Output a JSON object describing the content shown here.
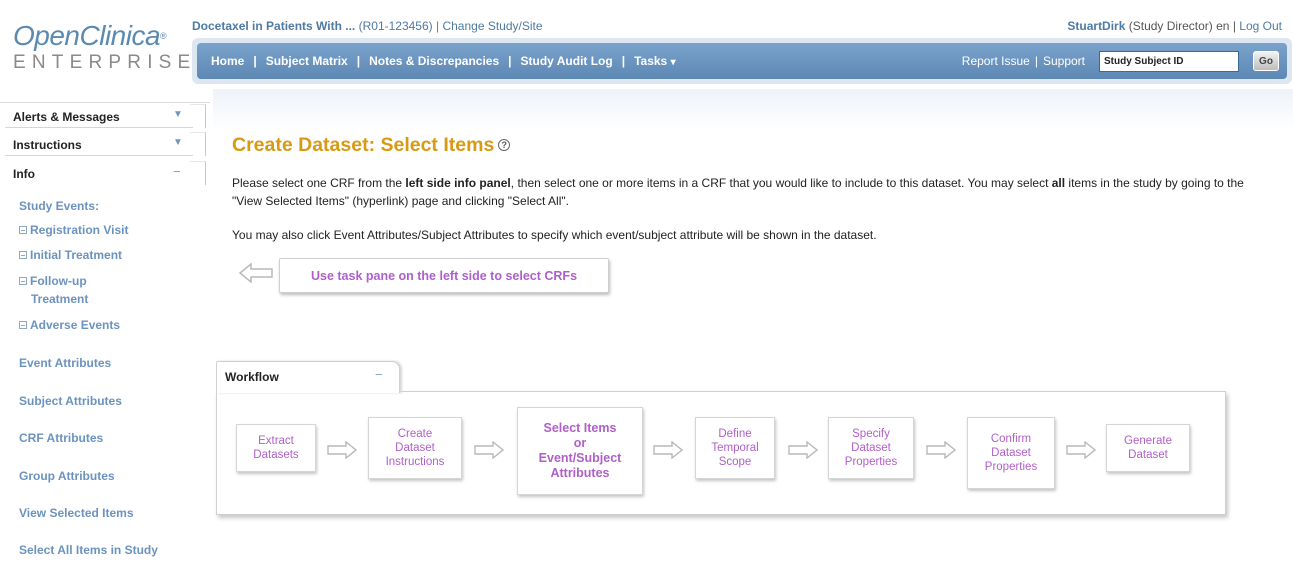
{
  "brand": {
    "name": "OpenClinica",
    "reg": "®",
    "edition": "ENTERPRISE"
  },
  "study": {
    "name": "Docetaxel in Patients With ...",
    "id": "(R01-123456)",
    "separator": "|",
    "change_link": "Change Study/Site"
  },
  "user": {
    "name": "StuartDirk",
    "role": "(Study Director)",
    "lang": "en",
    "separator": "|",
    "logout": "Log Out"
  },
  "nav": {
    "items": [
      "Home",
      "Subject Matrix",
      "Notes & Discrepancies",
      "Study Audit Log",
      "Tasks"
    ],
    "separator": "|",
    "tasks_caret": "▾",
    "report_issue": "Report Issue",
    "support": "Support",
    "right_separator": "|",
    "search_value": "Study Subject ID",
    "go_label": "Go"
  },
  "sidebar": {
    "panels": [
      {
        "title": "Alerts & Messages",
        "toggle": "▼"
      },
      {
        "title": "Instructions",
        "toggle": "▼"
      },
      {
        "title": "Info",
        "toggle": "−"
      }
    ],
    "study_events_label": "Study Events:",
    "events": [
      "Registration Visit",
      "Initial Treatment",
      "Follow-up",
      "Treatment",
      "Adverse Events"
    ],
    "links": [
      "Event Attributes",
      "Subject Attributes",
      "CRF Attributes",
      "Group Attributes",
      "View Selected Items",
      "Select All Items in Study"
    ]
  },
  "main": {
    "title": "Create Dataset: Select Items",
    "help_icon": "?",
    "para1_pre": "Please select one CRF from the ",
    "para1_bold": "left side info panel",
    "para1_mid": ", then select one or more items in a CRF that you would like to include to this dataset. You may select ",
    "para1_bold2": "all",
    "para1_post": " items in the study by going to the \"View Selected Items\" (hyperlink) page and clicking \"Select All\".",
    "para2": "You may also click Event Attributes/Subject Attributes to specify which event/subject attribute will be shown in the dataset.",
    "task_button": "Use task pane on the left side to select CRFs"
  },
  "workflow": {
    "title": "Workflow",
    "toggle": "−",
    "steps": [
      {
        "line1": "Extract",
        "line2": "Datasets",
        "line3": "",
        "line4": ""
      },
      {
        "line1": "Create",
        "line2": "Dataset",
        "line3": "Instructions",
        "line4": ""
      },
      {
        "line1": "Select Items",
        "line2": "or",
        "line3": "Event/Subject",
        "line4": "Attributes"
      },
      {
        "line1": "Define",
        "line2": "Temporal",
        "line3": "Scope",
        "line4": ""
      },
      {
        "line1": "Specify",
        "line2": "Dataset",
        "line3": "Properties",
        "line4": ""
      },
      {
        "line1": "Confirm",
        "line2": "Dataset",
        "line3": "Properties",
        "line4": ""
      },
      {
        "line1": "Generate",
        "line2": "Dataset",
        "line3": "",
        "line4": ""
      }
    ]
  },
  "colors": {
    "brand_blue": "#5a8ab0",
    "title_gold": "#d79a12",
    "step_purple": "#b05fca",
    "side_link_blue": "#6b93bf"
  }
}
